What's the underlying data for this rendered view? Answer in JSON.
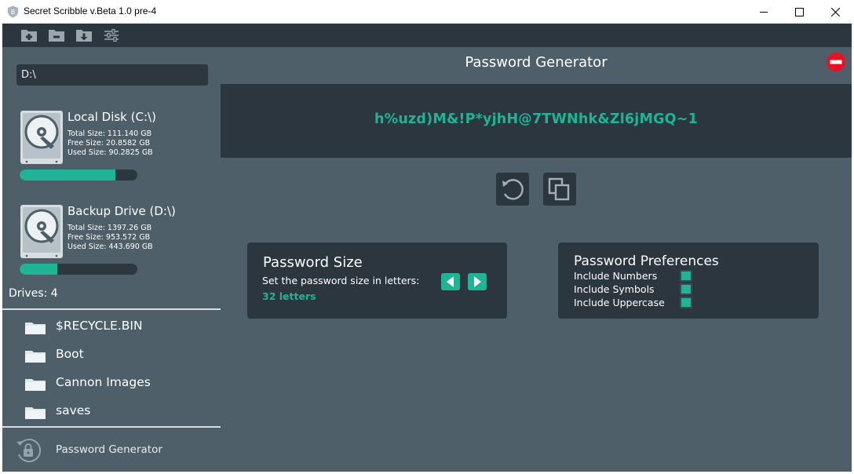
{
  "window": {
    "title": "Secret Scribble v.Beta 1.0 pre-4",
    "app_icon": "shield-b-icon",
    "controls": [
      "minimize-icon",
      "maximize-icon",
      "close-icon"
    ]
  },
  "toolbar": {
    "icons": [
      "folder-plus-icon",
      "folder-minus-icon",
      "folder-download-icon",
      "sliders-icon"
    ]
  },
  "sidebar": {
    "path_value": "D:\\",
    "drives": [
      {
        "name": "Local Disk (C:\\)",
        "total": "Total Size: 111.140 GB",
        "free": "Free Size: 20.8582 GB",
        "used": "Used Size: 90.2825 GB",
        "usage_fraction": 0.81
      },
      {
        "name": "Backup Drive (D:\\)",
        "total": "Total Size: 1397.26 GB",
        "free": "Free Size: 953.572 GB",
        "used": "Used Size: 443.690 GB",
        "usage_fraction": 0.32
      }
    ],
    "drives_count": "Drives: 4",
    "folders": [
      "$RECYCLE.BIN",
      "Boot",
      "Cannon Images",
      "saves"
    ],
    "nav_item": "Password Generator"
  },
  "main": {
    "title": "Password Generator",
    "password": "h%uzd)M&!P*yjhH@7TWNhk&Zl6jMGQ~1",
    "actions": [
      "refresh-icon",
      "copy-icon"
    ],
    "size_card": {
      "title": "Password Size",
      "description": "Set the password size in letters:",
      "value": "32 letters"
    },
    "prefs_card": {
      "title": "Password Preferences",
      "options": [
        {
          "label": "Include Numbers",
          "checked": true
        },
        {
          "label": "Include Symbols",
          "checked": true
        },
        {
          "label": "Include Uppercase",
          "checked": true
        }
      ]
    }
  },
  "colors": {
    "accent": "#1fb496",
    "panel": "#4e5f6a",
    "dark": "#2b363f",
    "danger": "#e81123"
  }
}
